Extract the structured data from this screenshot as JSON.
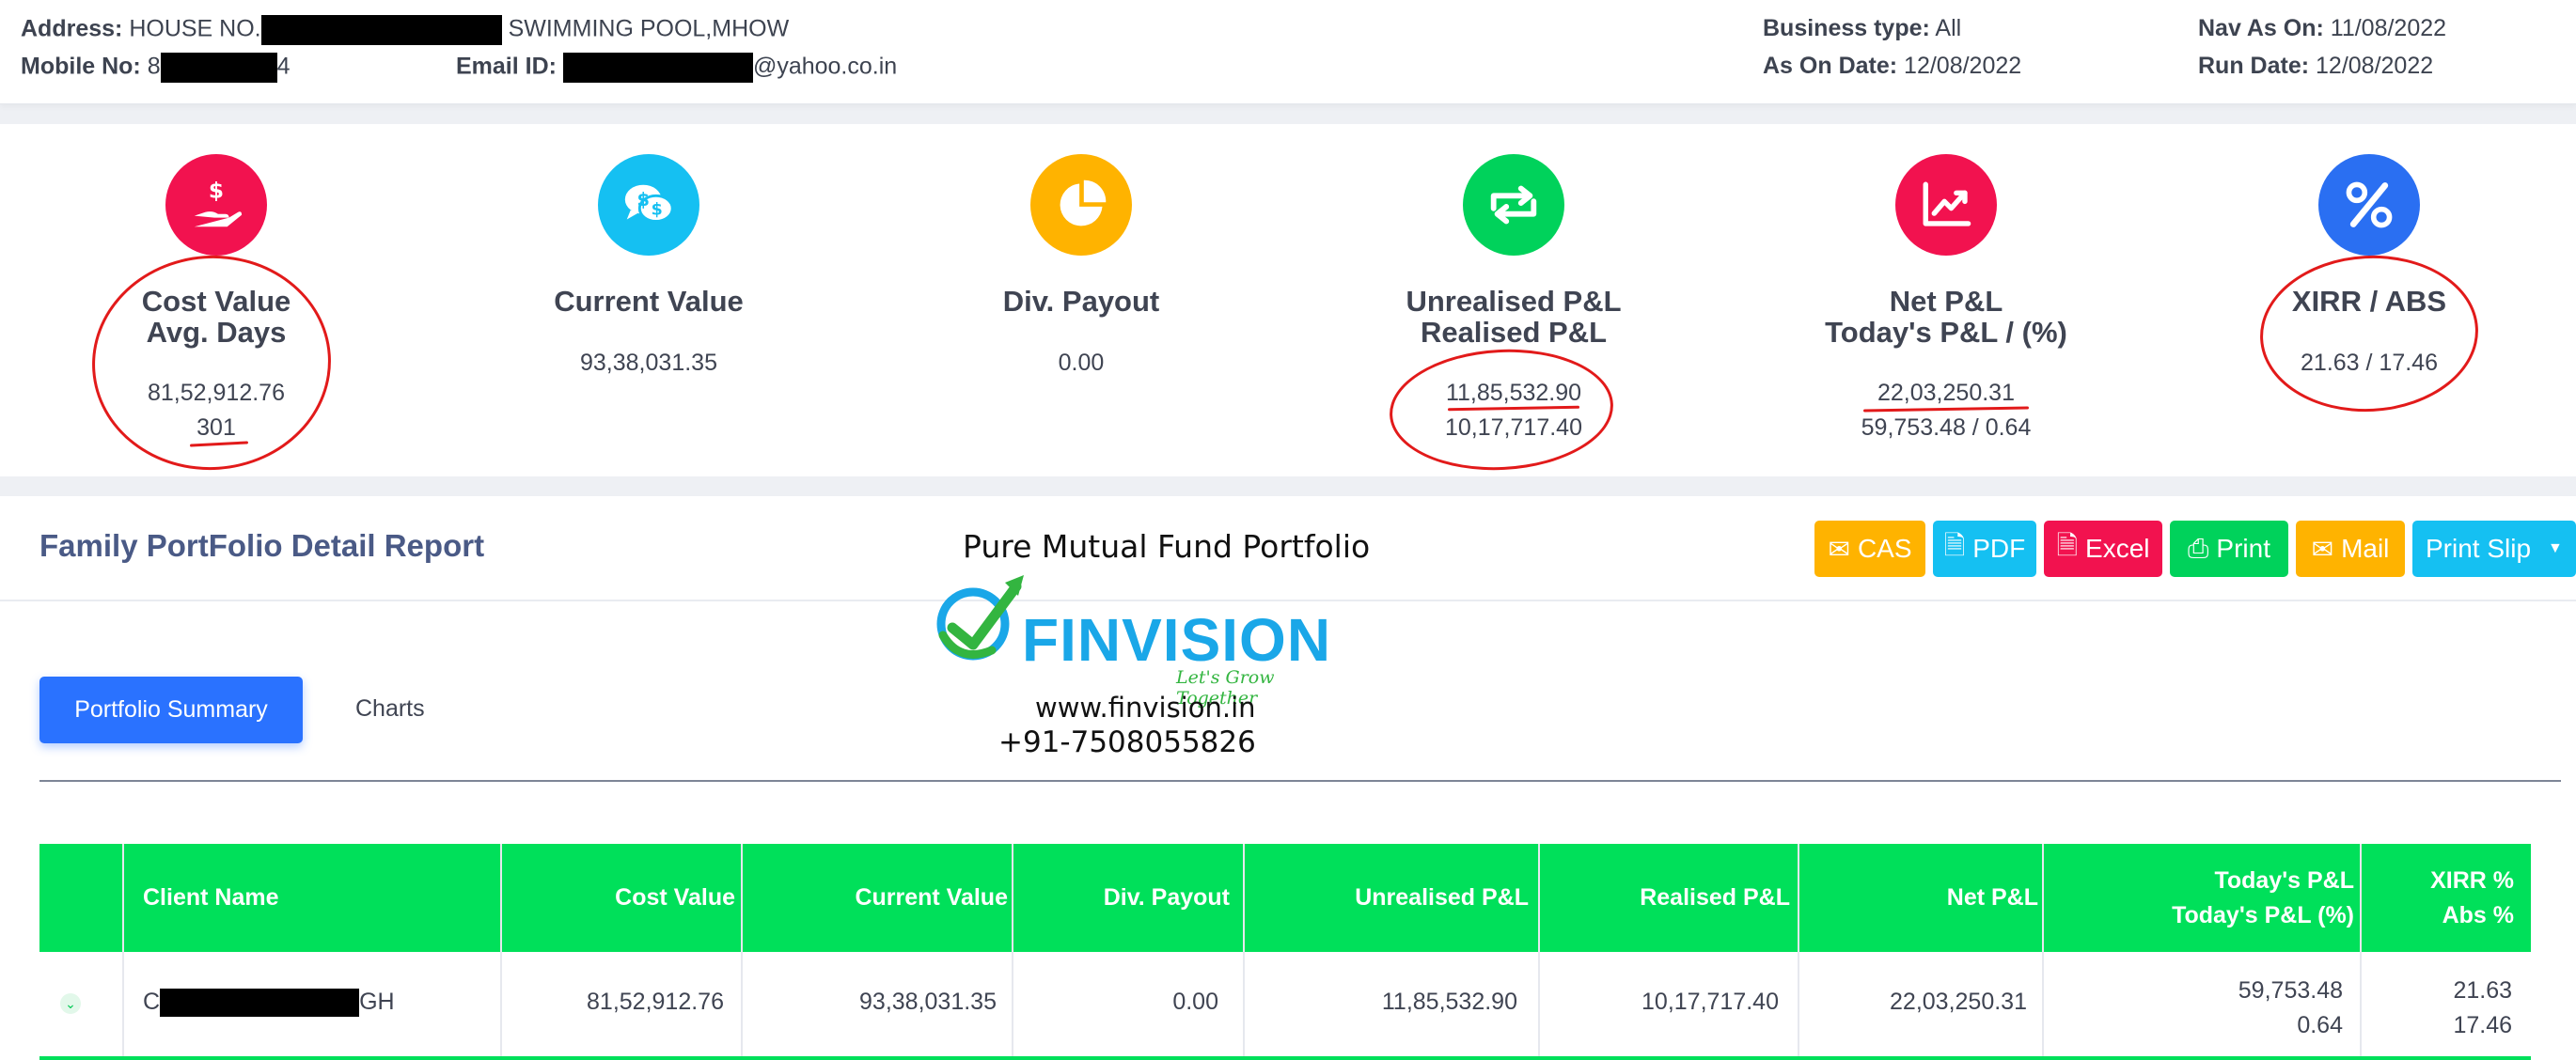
{
  "header": {
    "address_label": "Address:",
    "address_prefix": "HOUSE NO.",
    "address_suffix": "SWIMMING POOL,MHOW",
    "mobile_label": "Mobile No:",
    "mobile_prefix": "8",
    "mobile_suffix": "4",
    "email_label": "Email ID:",
    "email_suffix": "@yahoo.co.in",
    "business_type_label": "Business type:",
    "business_type_value": "All",
    "as_on_date_label": "As On Date:",
    "as_on_date_value": "12/08/2022",
    "nav_as_on_label": "Nav As On:",
    "nav_as_on_value": "11/08/2022",
    "run_date_label": "Run Date:",
    "run_date_value": "12/08/2022"
  },
  "cards": [
    {
      "icon": "hand-dollar-icon",
      "color": "#f2124f",
      "title1": "Cost Value",
      "title2": "Avg. Days",
      "value1": "81,52,912.76",
      "value2": "301"
    },
    {
      "icon": "chat-dollar-icon",
      "color": "#15c0f2",
      "title1": "Current Value",
      "value1": "93,38,031.35"
    },
    {
      "icon": "pie-chart-icon",
      "color": "#ffb300",
      "title1": "Div. Payout",
      "value1": "0.00"
    },
    {
      "icon": "exchange-arrows-icon",
      "color": "#00d25b",
      "title1": "Unrealised P&L",
      "title2": "Realised P&L",
      "value1": "11,85,532.90",
      "value2": "10,17,717.40"
    },
    {
      "icon": "trend-chart-icon",
      "color": "#f2124f",
      "title1": "Net P&L",
      "title2": "Today's P&L / (%)",
      "value1": "22,03,250.31",
      "value2": "59,753.48 / 0.64"
    },
    {
      "icon": "percent-icon",
      "color": "#2a6ff2",
      "title1": "XIRR / ABS",
      "value1": "21.63 / 17.46"
    }
  ],
  "report": {
    "title": "Family PortFolio Detail Report",
    "buttons": {
      "cas": "CAS",
      "pdf": "PDF",
      "excel": "Excel",
      "print": "Print",
      "mail": "Mail",
      "print_slip": "Print Slip"
    },
    "colors": {
      "cas": "#ffb300",
      "pdf": "#15c0f2",
      "excel": "#f2124f",
      "print": "#00d25b",
      "mail": "#ffb300",
      "print_slip": "#15c0f2"
    },
    "tabs": {
      "active": "Portfolio Summary",
      "other": "Charts"
    }
  },
  "promo": {
    "heading": "Pure Mutual Fund Portfolio",
    "brand": "FINVISION",
    "tagline": "Let's Grow Together",
    "website": "www.finvision.in",
    "phone": "+91-7508055826"
  },
  "table": {
    "headers": {
      "client_name": "Client Name",
      "cost_value": "Cost Value",
      "current_value": "Current Value",
      "div_payout": "Div. Payout",
      "unrealised": "Unrealised P&L",
      "realised": "Realised P&L",
      "net": "Net P&L",
      "todays1": "Today's P&L",
      "todays2": "Today's P&L (%)",
      "xirr1": "XIRR %",
      "xirr2": "Abs %"
    },
    "row": {
      "client_prefix": "C",
      "client_suffix": "GH",
      "cost_value": "81,52,912.76",
      "current_value": "93,38,031.35",
      "div_payout": "0.00",
      "unrealised": "11,85,532.90",
      "realised": "10,17,717.40",
      "net": "22,03,250.31",
      "todays_pl": "59,753.48",
      "todays_pct": "0.64",
      "xirr": "21.63",
      "abs": "17.46"
    }
  }
}
